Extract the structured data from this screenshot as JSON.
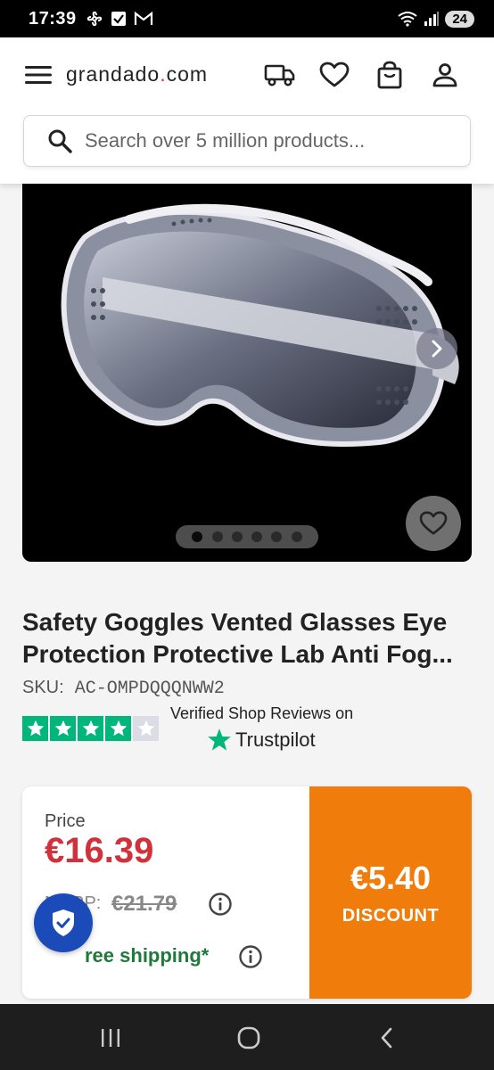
{
  "status_bar": {
    "time": "17:39",
    "battery": "24"
  },
  "header": {
    "logo_main": "grandado",
    "logo_dot": ".",
    "logo_tld": "com"
  },
  "search": {
    "placeholder": "Search over 5 million products..."
  },
  "gallery": {
    "total_images": 6,
    "active_index": 0
  },
  "product": {
    "title": "Safety Goggles Vented Glasses Eye Protection Protective Lab Anti Fog...",
    "sku_label": "SKU:",
    "sku_value": "AC-OMPDQQQNWW2"
  },
  "reviews": {
    "stars": 4,
    "max_stars": 5,
    "verified_text": "Verified Shop Reviews on",
    "brand": "Trustpilot"
  },
  "pricing": {
    "price_label": "Price",
    "price": "€16.39",
    "msrp_label": "MSRP:",
    "msrp": "€21.79",
    "shipping": "ree shipping*",
    "discount_amount": "€5.40",
    "discount_label": "DISCOUNT"
  },
  "colors": {
    "price_red": "#d0313b",
    "discount_orange": "#f07c0c",
    "trustpilot_green": "#00b67a",
    "shield_blue": "#1b4bb8"
  }
}
